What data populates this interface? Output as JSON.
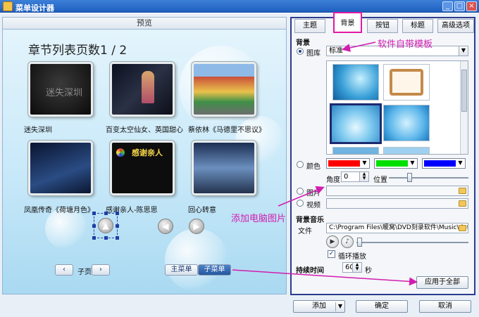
{
  "window": {
    "title": "菜单设计器",
    "controls": [
      "_",
      "□",
      "×"
    ]
  },
  "preview": {
    "header": "预览",
    "chapter_title": "章节列表页数1 / 2",
    "items": [
      {
        "caption": "迷失深圳",
        "thumb_text": "迷失深圳"
      },
      {
        "caption": "百变太空仙女、英国甜心",
        "thumb_text": ""
      },
      {
        "caption": "蔡依林《马德里不思议》",
        "thumb_text": ""
      },
      {
        "caption": "凤凰传奇《荷塘月色》",
        "thumb_text": ""
      },
      {
        "caption": "感谢亲人-陈思思",
        "thumb_text": "感谢亲人"
      },
      {
        "caption": "回心转意",
        "thumb_text": ""
      }
    ],
    "nav": {
      "prev": "‹",
      "label": "子页",
      "next": "›"
    },
    "menu_toggle": {
      "main": "主菜单",
      "sub": "子菜单"
    }
  },
  "tabs": [
    "主题",
    "背景",
    "按钮",
    "标题",
    "高级选项"
  ],
  "active_tab": "背景",
  "background": {
    "section_label": "背景",
    "library_label": "图库",
    "library_value": "标准",
    "color_label": "颜色",
    "colors": [
      "#ff0000",
      "#00e000",
      "#0000ff",
      "#ffffff"
    ],
    "angle_label": "角度",
    "angle_value": "0",
    "position_label": "位置",
    "image_label": "图片",
    "video_label": "视频"
  },
  "music": {
    "section_label": "背景音乐",
    "file_label": "文件",
    "file_value": "C:\\Program Files\\暖窝\\DVD刻录软件\\Music\\defa",
    "loop_label": "循环播放",
    "loop_checked": true
  },
  "duration": {
    "label": "持续时间",
    "value": "60",
    "unit": "秒"
  },
  "apply_all": "应用于全部",
  "footer": {
    "add": "添加",
    "ok": "确定",
    "cancel": "取消"
  },
  "annotations": {
    "builtin_template": "软件自带模板",
    "add_pc_image": "添加电脑图片"
  },
  "colors": {
    "accent_pink": "#d21db0",
    "panel_border": "#2a3d8f"
  }
}
